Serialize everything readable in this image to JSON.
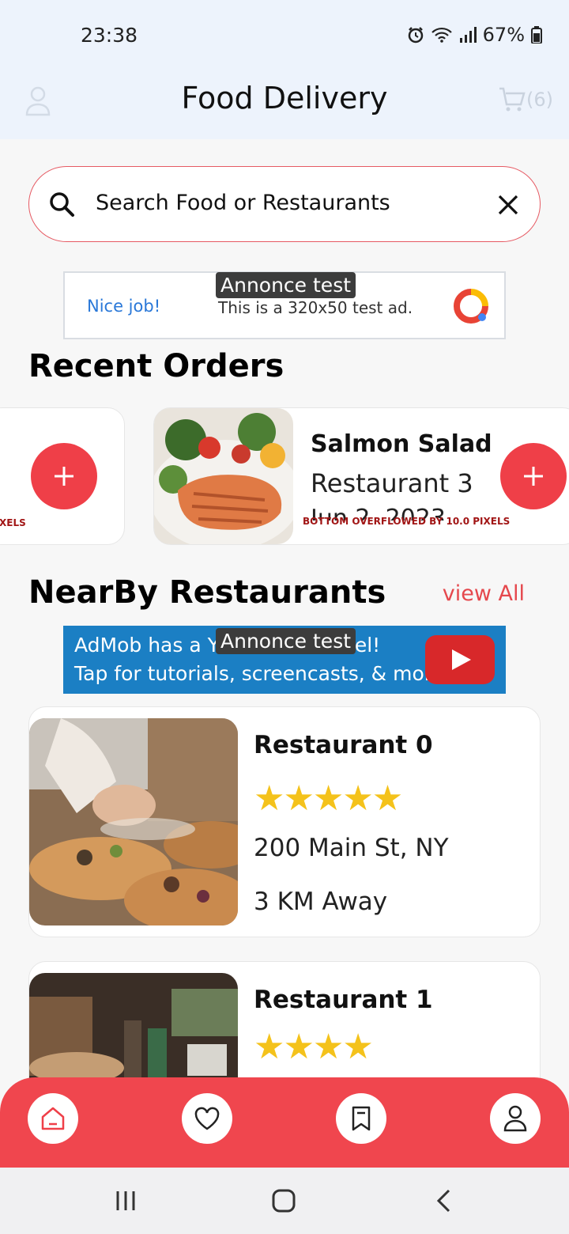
{
  "status": {
    "time": "23:38",
    "battery": "67%"
  },
  "app": {
    "title": "Food Delivery",
    "cart_count": "(6)"
  },
  "search": {
    "placeholder": "Search Food or Restaurants"
  },
  "ads": {
    "top": {
      "label": "Annonce test",
      "nice": "Nice job!",
      "text": "This is a 320x50 test ad."
    },
    "middle": {
      "label": "Annonce test",
      "line1": "AdMob has a YouTube channel!",
      "line2": "Tap for tutorials, screencasts, & more."
    }
  },
  "recent_orders": {
    "title": "Recent Orders",
    "left_overflow": "XELS",
    "item": {
      "name": "Salmon Salad",
      "restaurant": "Restaurant 3",
      "date": "Jun 2, 2023",
      "overflow": "BOTTOM OVERFLOWED BY 10.0 PIXELS"
    }
  },
  "nearby": {
    "title": "NearBy Restaurants",
    "view_all": "view All",
    "restaurants": [
      {
        "name": "Restaurant 0",
        "stars": "★★★★★",
        "rating": 5,
        "address": "200 Main St, NY",
        "distance": "3 KM Away"
      },
      {
        "name": "Restaurant 1",
        "stars": "★★★★",
        "rating": 4,
        "address": "",
        "distance": ""
      }
    ]
  },
  "bottom_nav": [
    {
      "icon": "home-icon"
    },
    {
      "icon": "heart-icon"
    },
    {
      "icon": "bookmark-icon"
    },
    {
      "icon": "profile-icon"
    }
  ],
  "colors": {
    "accent": "#ef3f48",
    "appbar": "#edf3fc",
    "star": "#f4c21b",
    "ad_blue": "#1b7fc4"
  }
}
